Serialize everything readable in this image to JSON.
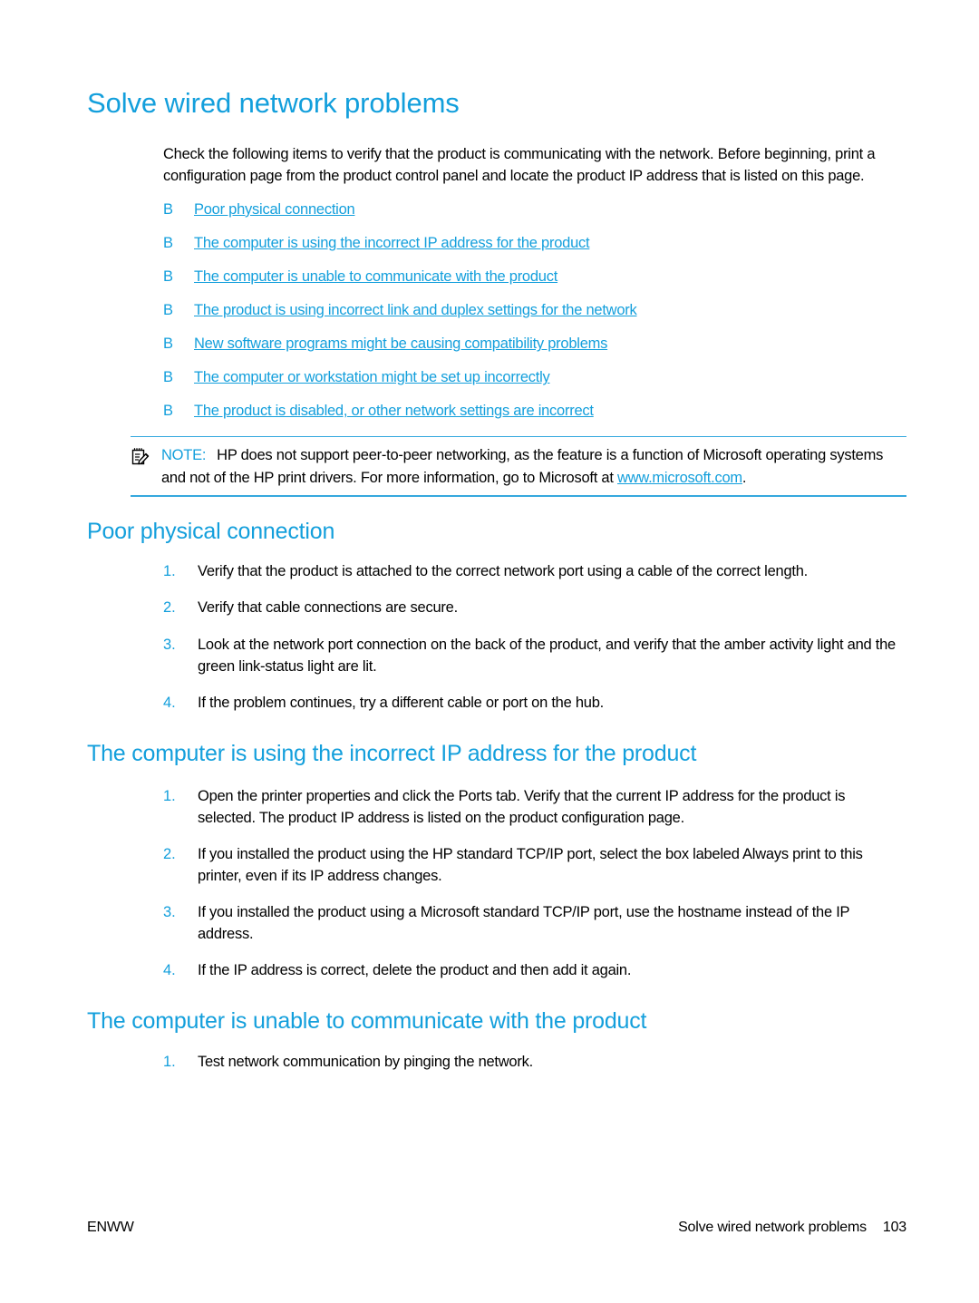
{
  "accent_color": "#139fdc",
  "text_color": "#000000",
  "page": {
    "title": "Solve wired network problems",
    "intro": "Check the following items to verify that the product is communicating with the network. Before beginning, print a configuration page from the product control panel and locate the product IP address that is listed on this page."
  },
  "bullet_glyph": "B",
  "link_list": [
    {
      "label": "Poor physical connection"
    },
    {
      "label": "The computer is using the incorrect IP address for the product"
    },
    {
      "label": "The computer is unable to communicate with the product"
    },
    {
      "label": "The product is using incorrect link and duplex settings for the network"
    },
    {
      "label": "New software programs might be causing compatibility problems"
    },
    {
      "label": "The computer or workstation might be set up incorrectly"
    },
    {
      "label": "The product is disabled, or other network settings are incorrect"
    }
  ],
  "note": {
    "icon": "note-pad-pencil-icon",
    "label": "NOTE:",
    "text_before_link": "HP does not support peer-to-peer networking, as the feature is a function of Microsoft operating systems and not of the HP print drivers. For more information, go to Microsoft at ",
    "link": "www.microsoft.com",
    "text_after_link": "."
  },
  "sections": [
    {
      "heading": "Poor physical connection",
      "steps": [
        {
          "num": "1.",
          "text": "Verify that the product is attached to the correct network port using a cable of the correct length."
        },
        {
          "num": "2.",
          "text": "Verify that cable connections are secure."
        },
        {
          "num": "3.",
          "text": "Look at the network port connection on the back of the product, and verify that the amber activity light and the green link-status light are lit."
        },
        {
          "num": "4.",
          "text": "If the problem continues, try a different cable or port on the hub."
        }
      ]
    },
    {
      "heading": "The computer is using the incorrect IP address for the product",
      "steps": [
        {
          "num": "1.",
          "text": "Open the printer properties and click the Ports tab. Verify that the current IP address for the product is selected. The product IP address is listed on the product configuration page."
        },
        {
          "num": "2.",
          "text": "If you installed the product using the HP standard TCP/IP port, select the box labeled Always print to this printer, even if its IP address changes."
        },
        {
          "num": "3.",
          "text": "If you installed the product using a Microsoft standard TCP/IP port, use the hostname instead of the IP address."
        },
        {
          "num": "4.",
          "text": "If the IP address is correct, delete the product and then add it again."
        }
      ]
    },
    {
      "heading": "The computer is unable to communicate with the product",
      "steps": [
        {
          "num": "1.",
          "text": "Test network communication by pinging the network."
        }
      ]
    }
  ],
  "footer": {
    "left": "ENWW",
    "chapter": "Solve wired network problems",
    "page_number": "103"
  }
}
